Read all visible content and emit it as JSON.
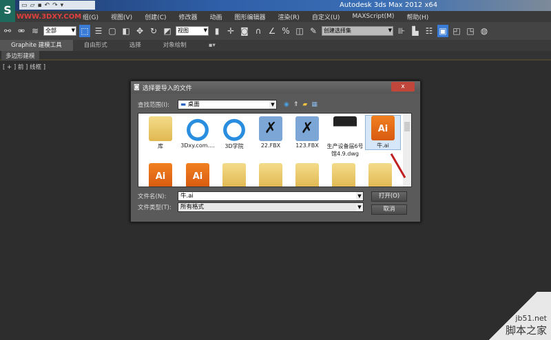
{
  "app": {
    "title": "Autodesk 3ds Max  2012 x64",
    "logo": "S",
    "watermark_site": "WWW.3DXY.COM"
  },
  "menu": [
    "组(G)",
    "视图(V)",
    "创建(C)",
    "修改器",
    "动画",
    "图形编辑器",
    "渲染(R)",
    "自定义(U)",
    "MAXScript(M)",
    "帮助(H)"
  ],
  "toolbar": {
    "filter_select": "全部",
    "view_select": "视图",
    "named_selection": "创建选择集"
  },
  "ribbon": {
    "tabs": [
      "Graphite 建模工具",
      "自由形式",
      "选择",
      "对象绘制"
    ],
    "sub_tab": "多边形建模"
  },
  "viewport": {
    "label": "[ + ] 前 ] 线框 ]"
  },
  "dialog": {
    "title": "选择要导入的文件",
    "close": "x",
    "look_in_label": "查找范围(I):",
    "look_in_value": "桌面",
    "files": [
      {
        "name": "库",
        "type": "folder"
      },
      {
        "name": "3Dxy.com....",
        "type": "cloud"
      },
      {
        "name": "3D学院",
        "type": "cloud"
      },
      {
        "name": "22.FBX",
        "type": "fbx"
      },
      {
        "name": "123.FBX",
        "type": "fbx"
      },
      {
        "name": "生产设备届6号馆4.9.dwg",
        "type": "dwg"
      },
      {
        "name": "牛.ai",
        "type": "ai",
        "selected": true
      }
    ],
    "row2_icons": [
      "ai",
      "ai",
      "folder",
      "folder",
      "folder",
      "folder",
      "folder"
    ],
    "filename_label": "文件名(N):",
    "filename_value": "牛.ai",
    "filetype_label": "文件类型(T):",
    "filetype_value": "所有格式",
    "open_button": "打开(O)",
    "cancel_button": "取消"
  },
  "watermark": {
    "url": "jb51.net",
    "name": "脚本之家"
  },
  "colors": {
    "accent": "#3a7bd5",
    "arrow": "#c02020"
  }
}
